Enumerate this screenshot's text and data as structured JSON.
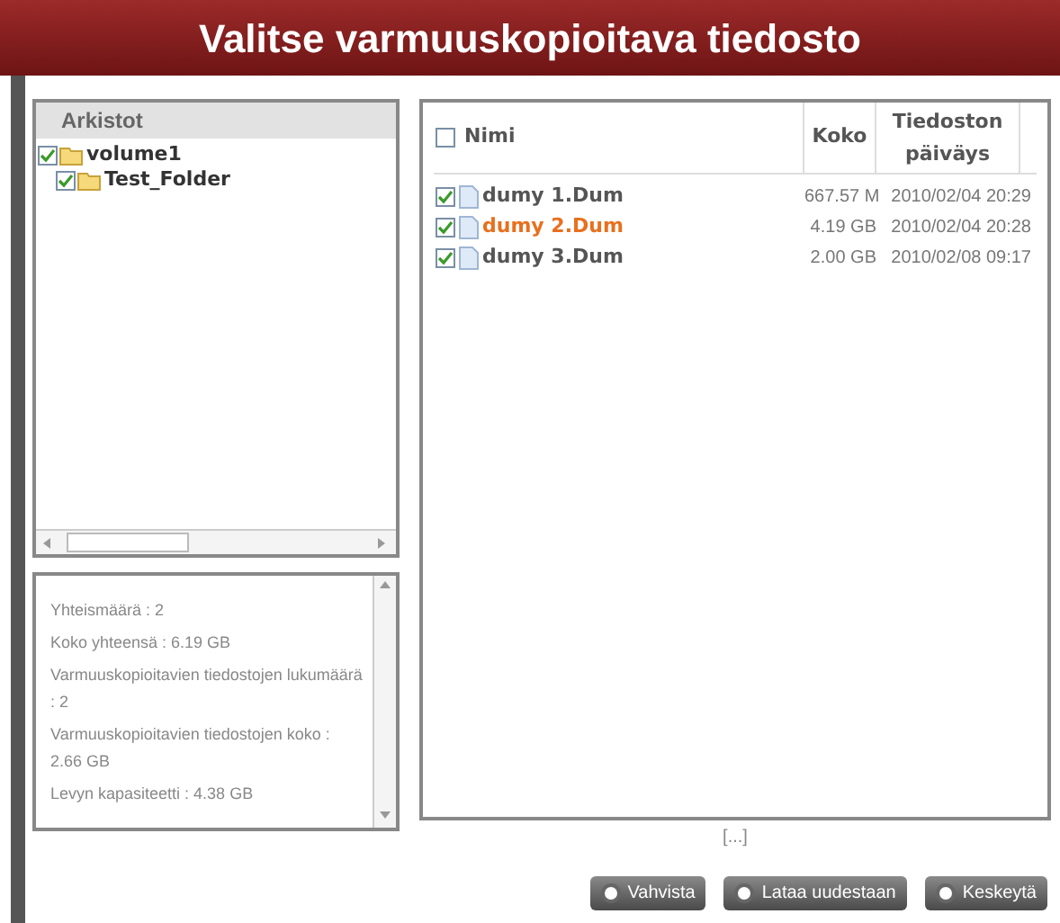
{
  "title": "Valitse varmuuskopioitava tiedosto",
  "tree": {
    "header": "Arkistot",
    "items": [
      {
        "label": "volume1",
        "checked": true,
        "children": [
          {
            "label": "Test_Folder",
            "checked": true
          }
        ]
      }
    ]
  },
  "summary": [
    "Yhteismäärä : 2",
    "Koko yhteensä : 6.19 GB",
    "Varmuuskopioitavien tiedostojen lukumäärä : 2",
    "Varmuuskopioitavien tiedostojen koko : 2.66 GB",
    "Levyn kapasiteetti : 4.38 GB"
  ],
  "files": {
    "all_checked": false,
    "columns": [
      "Nimi",
      "Koko",
      "Tiedoston päiväys"
    ],
    "rows": [
      {
        "name": "dumy 1.Dum",
        "size": "667.57 M",
        "date": "2010/02/04 20:29",
        "checked": true,
        "selected": false
      },
      {
        "name": "dumy 2.Dum",
        "size": "4.19 GB",
        "date": "2010/02/04 20:28",
        "checked": true,
        "selected": true
      },
      {
        "name": "dumy 3.Dum",
        "size": "2.00 GB",
        "date": "2010/02/08 09:17",
        "checked": true,
        "selected": false
      }
    ]
  },
  "pager": "[...]",
  "buttons": [
    "Vahvista",
    "Lataa uudestaan",
    "Keskeytä"
  ]
}
